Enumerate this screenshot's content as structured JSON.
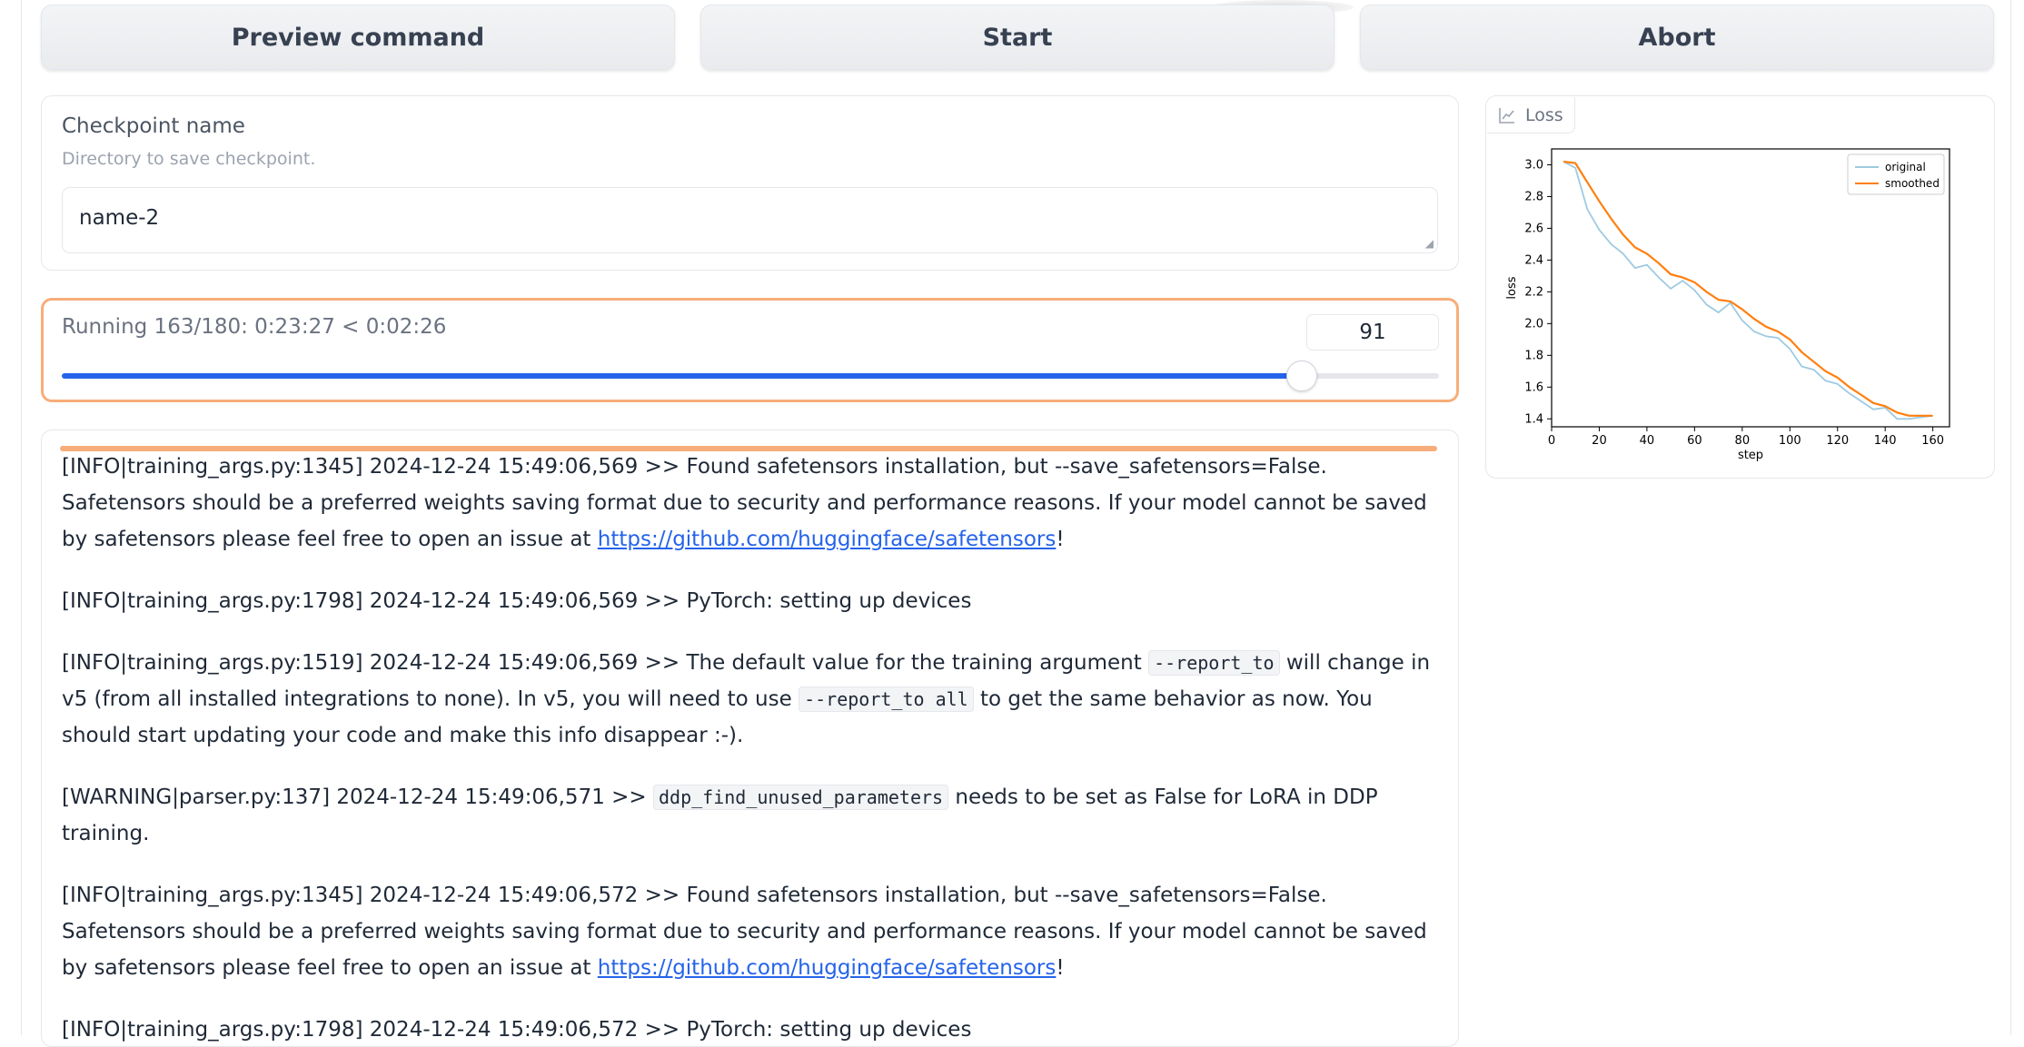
{
  "buttons": {
    "preview": "Preview command",
    "start": "Start",
    "abort": "Abort"
  },
  "checkpoint": {
    "label": "Checkpoint name",
    "info": "Directory to save checkpoint.",
    "value": "name-2"
  },
  "progress": {
    "label": "Running 163/180: 0:23:27 < 0:02:26",
    "number_value": "91",
    "slider_fraction": 0.9
  },
  "log": {
    "entries": [
      {
        "prefix": "[INFO|training_args.py:1345] 2024-12-24 15:49:06,569 >> Found safetensors installation, but --save_safetensors=False. Safetensors should be a preferred weights saving format due to security and performance reasons. If your model cannot be saved by safetensors please feel free to open an issue at ",
        "link": "https://github.com/huggingface/safetensors",
        "suffix": "!"
      },
      {
        "text": "[INFO|training_args.py:1798] 2024-12-24 15:49:06,569 >> PyTorch: setting up devices"
      },
      {
        "part1": "[INFO|training_args.py:1519] 2024-12-24 15:49:06,569 >> The default value for the training argument ",
        "code1": "--report_to",
        "part2": " will change in v5 (from all installed integrations to none). In v5, you will need to use ",
        "code2": "--report_to all",
        "part3": " to get the same behavior as now. You should start updating your code and make this info disappear :-)."
      },
      {
        "part1": "[WARNING|parser.py:137] 2024-12-24 15:49:06,571 >> ",
        "code1": "ddp_find_unused_parameters",
        "part2": " needs to be set as False for LoRA in DDP training."
      },
      {
        "prefix": "[INFO|training_args.py:1345] 2024-12-24 15:49:06,572 >> Found safetensors installation, but --save_safetensors=False. Safetensors should be a preferred weights saving format due to security and performance reasons. If your model cannot be saved by safetensors please feel free to open an issue at ",
        "link": "https://github.com/huggingface/safetensors",
        "suffix": "!"
      },
      {
        "text": "[INFO|training_args.py:1798] 2024-12-24 15:49:06,572 >> PyTorch: setting up devices"
      }
    ]
  },
  "chart_panel": {
    "tab_label": "Loss",
    "tab_icon": "line-chart-icon"
  },
  "chart_data": {
    "type": "line",
    "xlabel": "step",
    "ylabel": "loss",
    "xlim": [
      0,
      167
    ],
    "ylim": [
      1.35,
      3.1
    ],
    "xticks": [
      0,
      20,
      40,
      60,
      80,
      100,
      120,
      140,
      160
    ],
    "yticks": [
      1.4,
      1.6,
      1.8,
      2.0,
      2.2,
      2.4,
      2.6,
      2.8,
      3.0
    ],
    "legend_position": "top-right",
    "series": [
      {
        "name": "original",
        "color": "#9ecae1",
        "x": [
          5,
          10,
          15,
          20,
          25,
          30,
          35,
          40,
          45,
          50,
          55,
          60,
          65,
          70,
          75,
          80,
          85,
          90,
          95,
          100,
          105,
          110,
          115,
          120,
          125,
          130,
          135,
          140,
          145,
          150,
          155,
          160
        ],
        "values": [
          3.02,
          2.98,
          2.72,
          2.59,
          2.5,
          2.44,
          2.35,
          2.37,
          2.29,
          2.22,
          2.27,
          2.21,
          2.12,
          2.07,
          2.13,
          2.02,
          1.95,
          1.92,
          1.91,
          1.84,
          1.73,
          1.71,
          1.64,
          1.62,
          1.56,
          1.51,
          1.46,
          1.47,
          1.4,
          1.4,
          1.41,
          1.42
        ]
      },
      {
        "name": "smoothed",
        "color": "#ff7f0e",
        "x": [
          5,
          10,
          15,
          20,
          25,
          30,
          35,
          40,
          45,
          50,
          55,
          60,
          65,
          70,
          75,
          80,
          85,
          90,
          95,
          100,
          105,
          110,
          115,
          120,
          125,
          130,
          135,
          140,
          145,
          150,
          155,
          160
        ],
        "values": [
          3.02,
          3.01,
          2.89,
          2.77,
          2.66,
          2.56,
          2.48,
          2.44,
          2.38,
          2.31,
          2.29,
          2.26,
          2.2,
          2.15,
          2.14,
          2.09,
          2.03,
          1.98,
          1.95,
          1.9,
          1.82,
          1.76,
          1.7,
          1.66,
          1.6,
          1.55,
          1.5,
          1.48,
          1.44,
          1.42,
          1.42,
          1.42
        ]
      }
    ]
  }
}
